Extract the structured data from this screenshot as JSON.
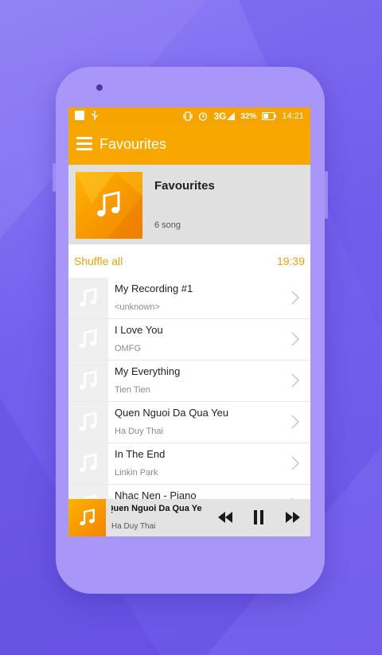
{
  "status_bar": {
    "network": "3G",
    "battery": "32%",
    "time": "14:21"
  },
  "toolbar": {
    "title": "Favourites",
    "menu_icon": "hamburger-menu-icon"
  },
  "header": {
    "title": "Favourites",
    "count": "6 song",
    "art_icon": "music-note-icon"
  },
  "shuffle": {
    "label": "Shuffle all",
    "total_duration": "19:39"
  },
  "songs": [
    {
      "title": "My Recording #1",
      "artist": "<unknown>"
    },
    {
      "title": "I Love You",
      "artist": "OMFG"
    },
    {
      "title": "My Everything",
      "artist": "Tien Tien"
    },
    {
      "title": "Quen Nguoi Da Qua Yeu",
      "artist": "Ha Duy Thai"
    },
    {
      "title": "In The End",
      "artist": "Linkin Park"
    },
    {
      "title": "Nhac Nen - Piano",
      "artist": ""
    }
  ],
  "now_playing": {
    "title": "Quen Nguoi Da Qua Yeu",
    "artist": "Ha Duy Thai",
    "controls": [
      "rewind-icon",
      "pause-icon",
      "fast-forward-icon"
    ]
  },
  "colors": {
    "accent": "#f7a700",
    "background": "#7560ee"
  }
}
